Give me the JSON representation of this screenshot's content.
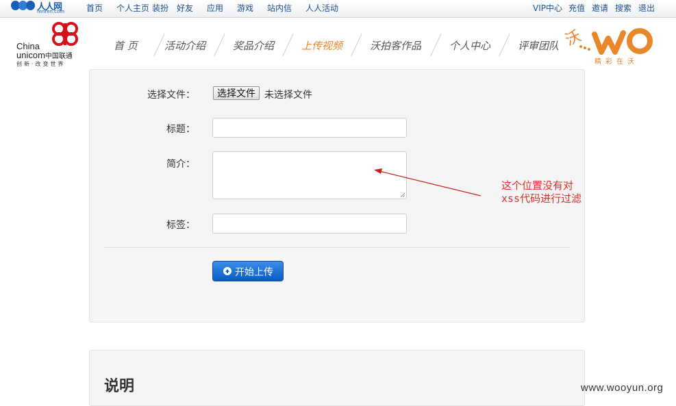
{
  "topbar": {
    "logo": {
      "name": "人人网",
      "domain": "renren.com"
    },
    "left_links": [
      "首页",
      "个人主页",
      "装扮",
      "好友",
      "应用",
      "游戏",
      "站内信",
      "人人活动"
    ],
    "right_links": [
      "VIP中心",
      "充值",
      "邀请",
      "搜索",
      "退出"
    ]
  },
  "header": {
    "unicom_logo": {
      "line1": "China",
      "line2": "unicom",
      "line2_cn": "中国联通",
      "slogan": "创新·改变世界"
    },
    "nav": [
      "首 页",
      "活动介绍",
      "奖品介绍",
      "上传视频",
      "沃拍客作品",
      "个人中心",
      "评审团队"
    ],
    "active_nav": "上传视频",
    "wo_logo": {
      "mark": "沃",
      "tagline": "精彩在沃"
    }
  },
  "form": {
    "file_label": "选择文件：",
    "file_button": "选择文件",
    "file_status": "未选择文件",
    "title_label": "标题：",
    "title_value": "",
    "intro_label": "简介：",
    "intro_value": "",
    "tags_label": "标签：",
    "tags_value": "",
    "submit_label": "开始上传"
  },
  "annotation": {
    "line1": "这个位置没有对",
    "line2": "xss代码进行过滤",
    "color": "#e0302a"
  },
  "section": {
    "title": "说明"
  },
  "watermark": "www.wooyun.org",
  "colors": {
    "accent_orange": "#e8862a",
    "link_blue": "#1d4f8c",
    "button_blue": "#0b5bc4",
    "unicom_red": "#d6101c"
  }
}
